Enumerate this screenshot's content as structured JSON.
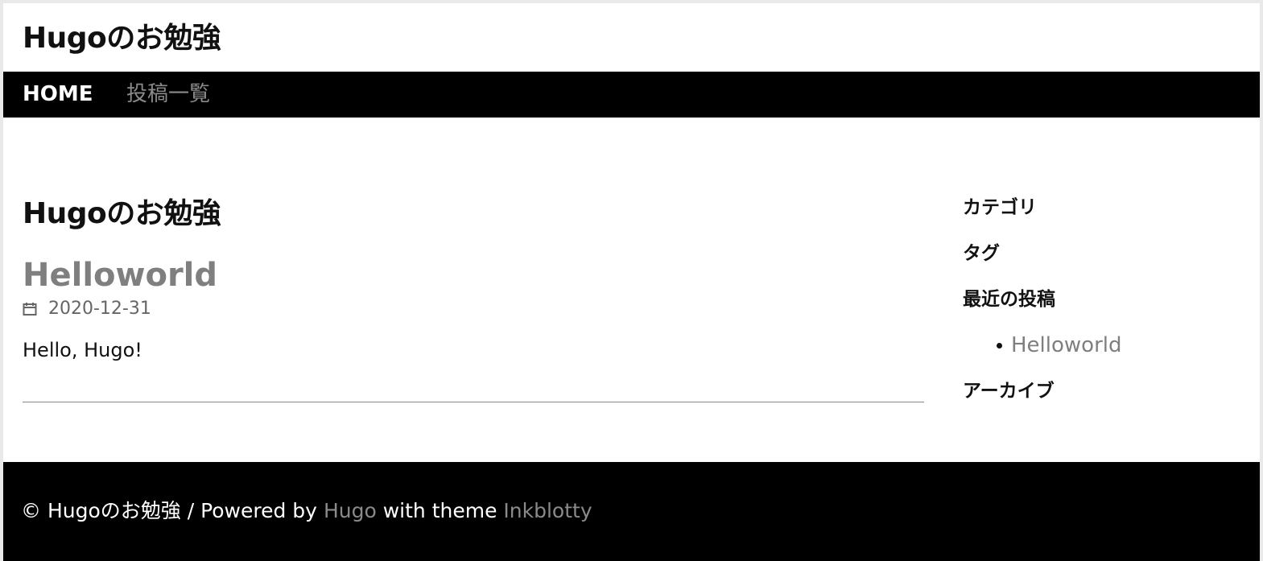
{
  "header": {
    "site_title": "Hugoのお勉強"
  },
  "nav": {
    "items": [
      {
        "label": "HOME"
      },
      {
        "label": "投稿一覧"
      }
    ]
  },
  "main": {
    "section_title": "Hugoのお勉強",
    "post": {
      "title": "Helloworld",
      "date": "2020-12-31",
      "summary": "Hello, Hugo!"
    }
  },
  "sidebar": {
    "categories_heading": "カテゴリ",
    "tags_heading": "タグ",
    "recent_heading": "最近の投稿",
    "recent_posts": [
      {
        "title": "Helloworld"
      }
    ],
    "archive_heading": "アーカイブ"
  },
  "footer": {
    "copyright": "© Hugoのお勉強 / Powered by",
    "hugo_link": "Hugo",
    "with_theme": "with theme",
    "theme_link": "Inkblotty"
  },
  "icons": {
    "date": "calendar-icon"
  },
  "colors": {
    "nav_background": "#000000",
    "footer_background": "#000000",
    "link_gray": "#7f7f7f",
    "text_dark": "#111111"
  }
}
